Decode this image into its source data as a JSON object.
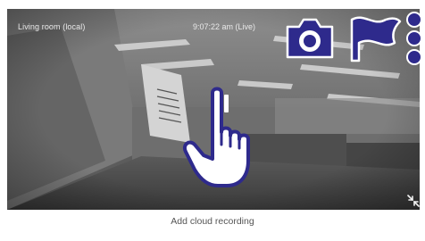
{
  "camera": {
    "name": "Living room (local)",
    "time": "9:07:22 am (Live)"
  },
  "controls": {
    "pause_icon": "pause-icon",
    "expand_icon": "collapse-arrows-icon",
    "snapshot_icon": "camera-icon",
    "flag_icon": "flag-icon",
    "more_icon": "more-vertical-icon"
  },
  "overlay": {
    "pointer_icon": "hand-pointer-icon",
    "accent_color": "#2e2a8c"
  },
  "footer": {
    "cloud_label": "Add cloud recording"
  }
}
